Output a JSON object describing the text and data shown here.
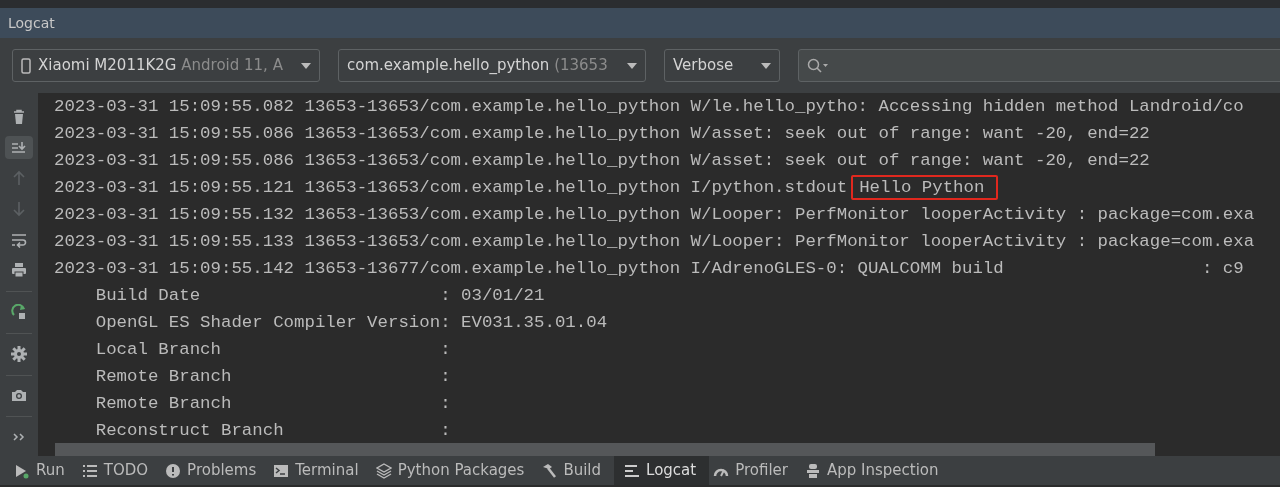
{
  "panel": {
    "title": "Logcat"
  },
  "filters": {
    "device": {
      "name": "Xiaomi M2011K2G",
      "detail": "Android 11, A"
    },
    "process": {
      "name": "com.example.hello_python",
      "detail": "(13653"
    },
    "level": "Verbose"
  },
  "side_tools": [
    {
      "kind": "clear",
      "selected": false,
      "disabled": false
    },
    {
      "kind": "scroll-end",
      "selected": true,
      "disabled": false
    },
    {
      "kind": "up",
      "selected": false,
      "disabled": true
    },
    {
      "kind": "down",
      "selected": false,
      "disabled": true
    },
    {
      "kind": "wrap",
      "selected": false,
      "disabled": false
    },
    {
      "kind": "print",
      "selected": false,
      "disabled": false
    },
    {
      "kind": "restart",
      "selected": false,
      "disabled": false
    },
    {
      "kind": "settings",
      "selected": false,
      "disabled": false
    },
    {
      "kind": "screenshot",
      "selected": false,
      "disabled": false
    },
    {
      "kind": "more",
      "selected": false,
      "disabled": false
    }
  ],
  "log_lines": [
    {
      "text": "2023-03-31 15:09:55.082 13653-13653/com.example.hello_python W/le.hello_pytho: Accessing hidden method Landroid/co"
    },
    {
      "text": "2023-03-31 15:09:55.086 13653-13653/com.example.hello_python W/asset: seek out of range: want -20, end=22"
    },
    {
      "text": "2023-03-31 15:09:55.086 13653-13653/com.example.hello_python W/asset: seek out of range: want -20, end=22"
    },
    {
      "text": "2023-03-31 15:09:55.121 13653-13653/com.example.hello_python I/python.stdout",
      "highlight": "Hello Python"
    },
    {
      "text": "2023-03-31 15:09:55.132 13653-13653/com.example.hello_python W/Looper: PerfMonitor looperActivity : package=com.exa"
    },
    {
      "text": "2023-03-31 15:09:55.133 13653-13653/com.example.hello_python W/Looper: PerfMonitor looperActivity : package=com.exa"
    },
    {
      "text": "2023-03-31 15:09:55.142 13653-13677/com.example.hello_python I/AdrenoGLES-0: QUALCOMM build                   : c9"
    },
    {
      "text": "    Build Date                       : 03/01/21"
    },
    {
      "text": "    OpenGL ES Shader Compiler Version: EV031.35.01.04"
    },
    {
      "text": "    Local Branch                     :"
    },
    {
      "text": "    Remote Branch                    :"
    },
    {
      "text": "    Remote Branch                    :"
    },
    {
      "text": "    Reconstruct Branch               :"
    }
  ],
  "tool_tabs": [
    {
      "kind": "run",
      "label": "Run",
      "selected": false
    },
    {
      "kind": "todo",
      "label": "TODO",
      "selected": false
    },
    {
      "kind": "problems",
      "label": "Problems",
      "selected": false
    },
    {
      "kind": "terminal",
      "label": "Terminal",
      "selected": false
    },
    {
      "kind": "packages",
      "label": "Python Packages",
      "selected": false
    },
    {
      "kind": "build",
      "label": "Build",
      "selected": false
    },
    {
      "kind": "logcat",
      "label": "Logcat",
      "selected": true
    },
    {
      "kind": "profiler",
      "label": "Profiler",
      "selected": false
    },
    {
      "kind": "inspection",
      "label": "App Inspection",
      "selected": false
    }
  ]
}
